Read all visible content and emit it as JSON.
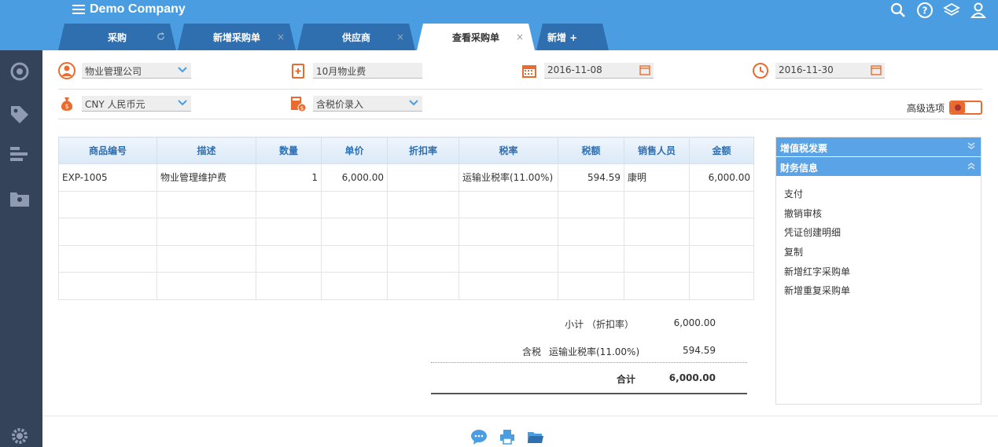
{
  "app": {
    "title": "Demo Company"
  },
  "tabs": [
    {
      "label": "采购",
      "close": ""
    },
    {
      "label": "新增采购单",
      "close": "×"
    },
    {
      "label": "供应商",
      "close": "×"
    },
    {
      "label": "查看采购单",
      "close": "×"
    },
    {
      "label": "新增 +"
    }
  ],
  "form": {
    "vendor": "物业管理公司",
    "memo": "10月物业费",
    "date": "2016-11-08",
    "due_date": "2016-11-30",
    "currency": "CNY 人民币元",
    "price_mode": "含税价录入",
    "advanced_label": "高级选项"
  },
  "table": {
    "headers": [
      "商品编号",
      "描述",
      "数量",
      "单价",
      "折扣率",
      "税率",
      "税额",
      "销售人员",
      "金额"
    ],
    "rows": [
      [
        "EXP-1005",
        "物业管理维护费",
        "1",
        "6,000.00",
        "",
        "运输业税率(11.00%)",
        "594.59",
        "康明",
        "6,000.00"
      ],
      [
        "",
        "",
        "",
        "",
        "",
        "",
        "",
        "",
        ""
      ],
      [
        "",
        "",
        "",
        "",
        "",
        "",
        "",
        "",
        ""
      ],
      [
        "",
        "",
        "",
        "",
        "",
        "",
        "",
        "",
        ""
      ],
      [
        "",
        "",
        "",
        "",
        "",
        "",
        "",
        "",
        ""
      ]
    ]
  },
  "totals": {
    "subtotal_label": "小计 （折扣率）",
    "subtotal_value": "6,000.00",
    "tax_prefix": "含税",
    "tax_label": "运输业税率(11.00%)",
    "tax_value": "594.59",
    "total_label": "合计",
    "total_value": "6,000.00"
  },
  "panel": {
    "section1": "增值税发票",
    "section2": "财务信息",
    "actions": [
      "支付",
      "撤销审核",
      "凭证创建明细",
      "复制",
      "新增红字采购单",
      "新增重复采购单"
    ]
  },
  "colors": {
    "topbar": "#4a9de0",
    "tab": "#2f6fb0",
    "sidebar": "#35435a",
    "accent": "#e96b2f"
  }
}
